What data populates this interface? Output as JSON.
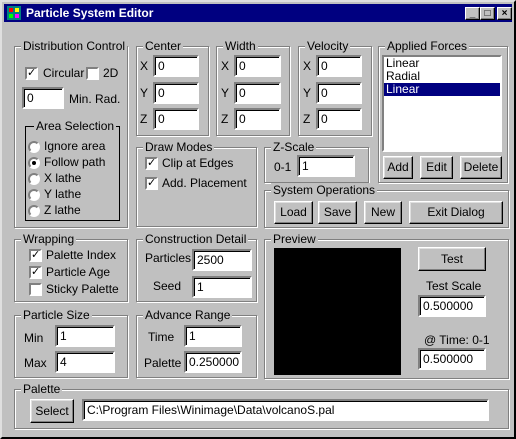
{
  "window": {
    "title": "Particle System Editor",
    "min": "_",
    "max": "□",
    "close": "×"
  },
  "distribution": {
    "legend": "Distribution Control",
    "circular_label": "Circular",
    "circular": "✓",
    "twod_label": "2D",
    "twod": "",
    "minrad_value": "0",
    "minrad_label": "Min. Rad.",
    "area": {
      "legend": "Area Selection",
      "options": [
        "Ignore area",
        "Follow path",
        "X lathe",
        "Y lathe",
        "Z lathe"
      ]
    }
  },
  "center": {
    "legend": "Center",
    "x": "0",
    "y": "0",
    "z": "0"
  },
  "width": {
    "legend": "Width",
    "x": "0",
    "y": "0",
    "z": "0"
  },
  "velocity": {
    "legend": "Velocity",
    "x": "0",
    "y": "0",
    "z": "0"
  },
  "axes": {
    "x": "X",
    "y": "Y",
    "z": "Z"
  },
  "forces": {
    "legend": "Applied Forces",
    "items": [
      "Linear",
      "Radial",
      "Linear"
    ],
    "add": "Add",
    "edit": "Edit",
    "delete": "Delete"
  },
  "draw_modes": {
    "legend": "Draw Modes",
    "clip": "Clip at Edges",
    "clip_mark": "✓",
    "add": "Add. Placement",
    "add_mark": "✓"
  },
  "zscale": {
    "legend": "Z-Scale",
    "range": "0-1",
    "value": "1"
  },
  "sysops": {
    "legend": "System Operations",
    "load": "Load",
    "save": "Save",
    "new": "New",
    "exit": "Exit Dialog"
  },
  "wrapping": {
    "legend": "Wrapping",
    "palette_index": "Palette Index",
    "pi_mark": "✓",
    "particle_age": "Particle Age",
    "pa_mark": "✓",
    "sticky": "Sticky Palette",
    "st_mark": ""
  },
  "construction": {
    "legend": "Construction Detail",
    "particles_label": "Particles",
    "particles": "2500",
    "seed_label": "Seed",
    "seed": "1"
  },
  "preview": {
    "legend": "Preview",
    "test": "Test",
    "scale_label": "Test Scale",
    "scale": "0.500000",
    "time_label": "@ Time: 0-1",
    "time": "0.500000"
  },
  "particle_size": {
    "legend": "Particle Size",
    "min_label": "Min",
    "min": "1",
    "max_label": "Max",
    "max": "4"
  },
  "advance": {
    "legend": "Advance Range",
    "time_label": "Time",
    "time": "1",
    "palette_label": "Palette",
    "palette": "0.250000"
  },
  "palette": {
    "legend": "Palette",
    "select": "Select",
    "path": "C:\\Program Files\\Winimage\\Data\\volcanoS.pal"
  }
}
